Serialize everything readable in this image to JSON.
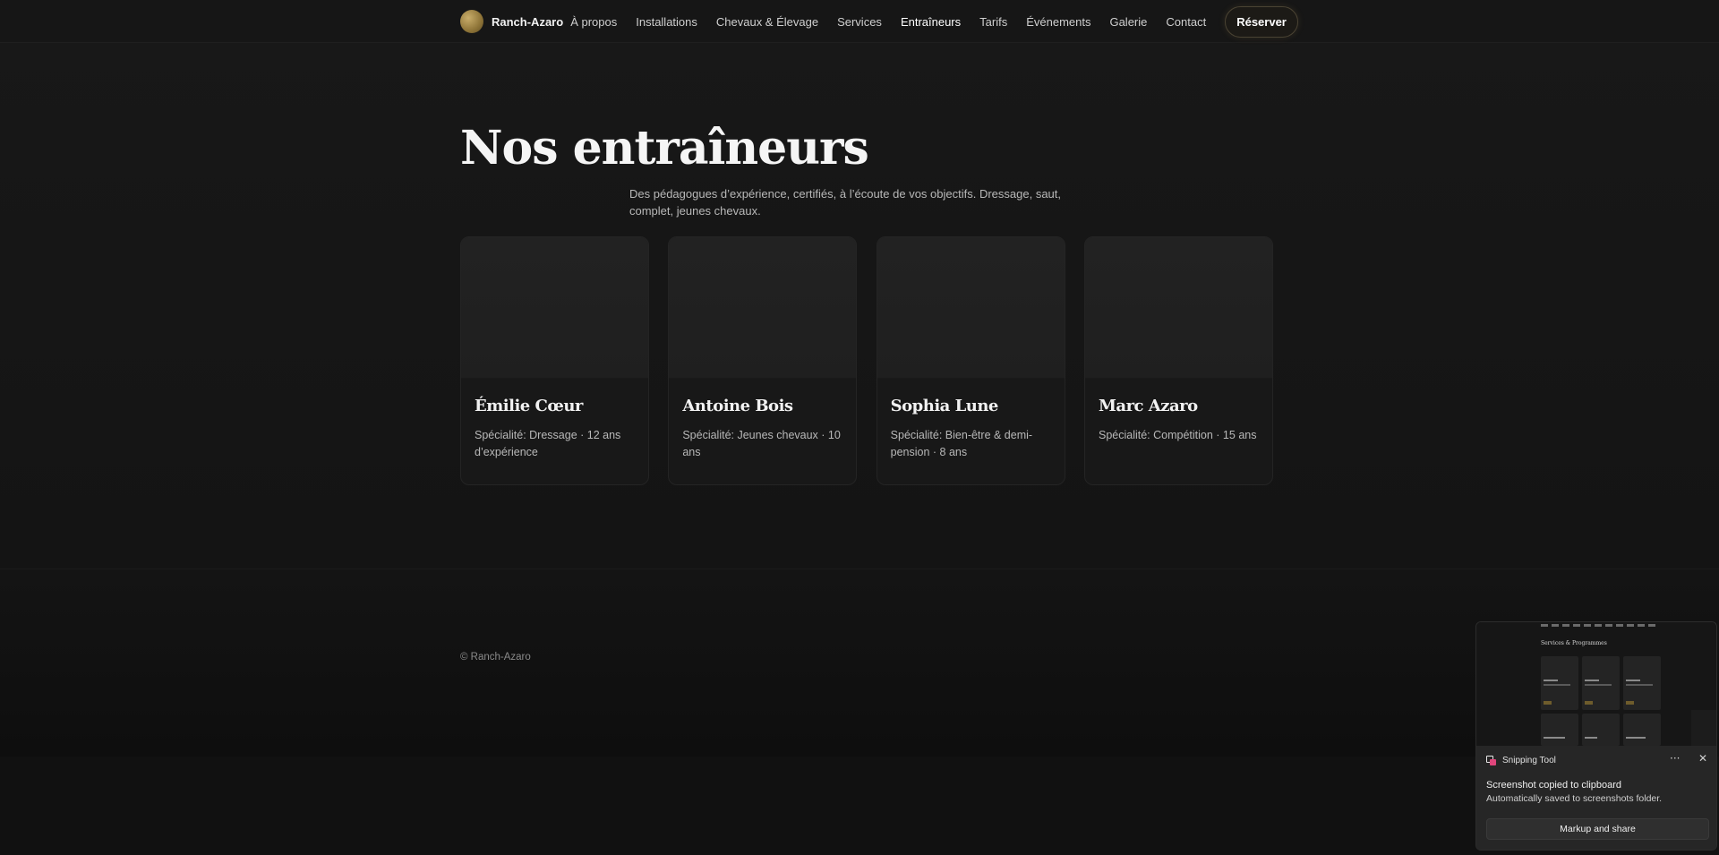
{
  "header": {
    "brand": "Ranch-Azaro",
    "nav": [
      {
        "label": "À propos"
      },
      {
        "label": "Installations"
      },
      {
        "label": "Chevaux & Élevage"
      },
      {
        "label": "Services"
      },
      {
        "label": "Entraîneurs",
        "active": true
      },
      {
        "label": "Tarifs"
      },
      {
        "label": "Événements"
      },
      {
        "label": "Galerie"
      },
      {
        "label": "Contact"
      }
    ],
    "cta_label": "Réserver"
  },
  "hero": {
    "title": "Nos entraîneurs",
    "subtitle": "Des pédagogues d’expérience, certifiés, à l’écoute de vos objectifs. Dressage, saut, complet, jeunes chevaux."
  },
  "trainers": [
    {
      "name": "Émilie Cœur",
      "description": "Spécialité: Dressage · 12 ans d’expérience"
    },
    {
      "name": "Antoine Bois",
      "description": "Spécialité: Jeunes chevaux · 10 ans"
    },
    {
      "name": "Sophia Lune",
      "description": "Spécialité: Bien-être & demi-pension · 8 ans"
    },
    {
      "name": "Marc Azaro",
      "description": "Spécialité: Compétition · 15 ans"
    }
  ],
  "footer": {
    "copyright": "© Ranch-Azaro"
  },
  "notification": {
    "app_name": "Snipping Tool",
    "heading": "Screenshot copied to clipboard",
    "message": "Automatically saved to screenshots folder.",
    "action_label": "Markup and share",
    "more_glyph": "···",
    "close_glyph": "✕",
    "thumbnail_title": "Services & Programmes"
  },
  "colors": {
    "background": "#121212",
    "accent_gold": "#b3934f",
    "text_primary": "#f2f2f2",
    "text_secondary": "#b8b8b8"
  }
}
